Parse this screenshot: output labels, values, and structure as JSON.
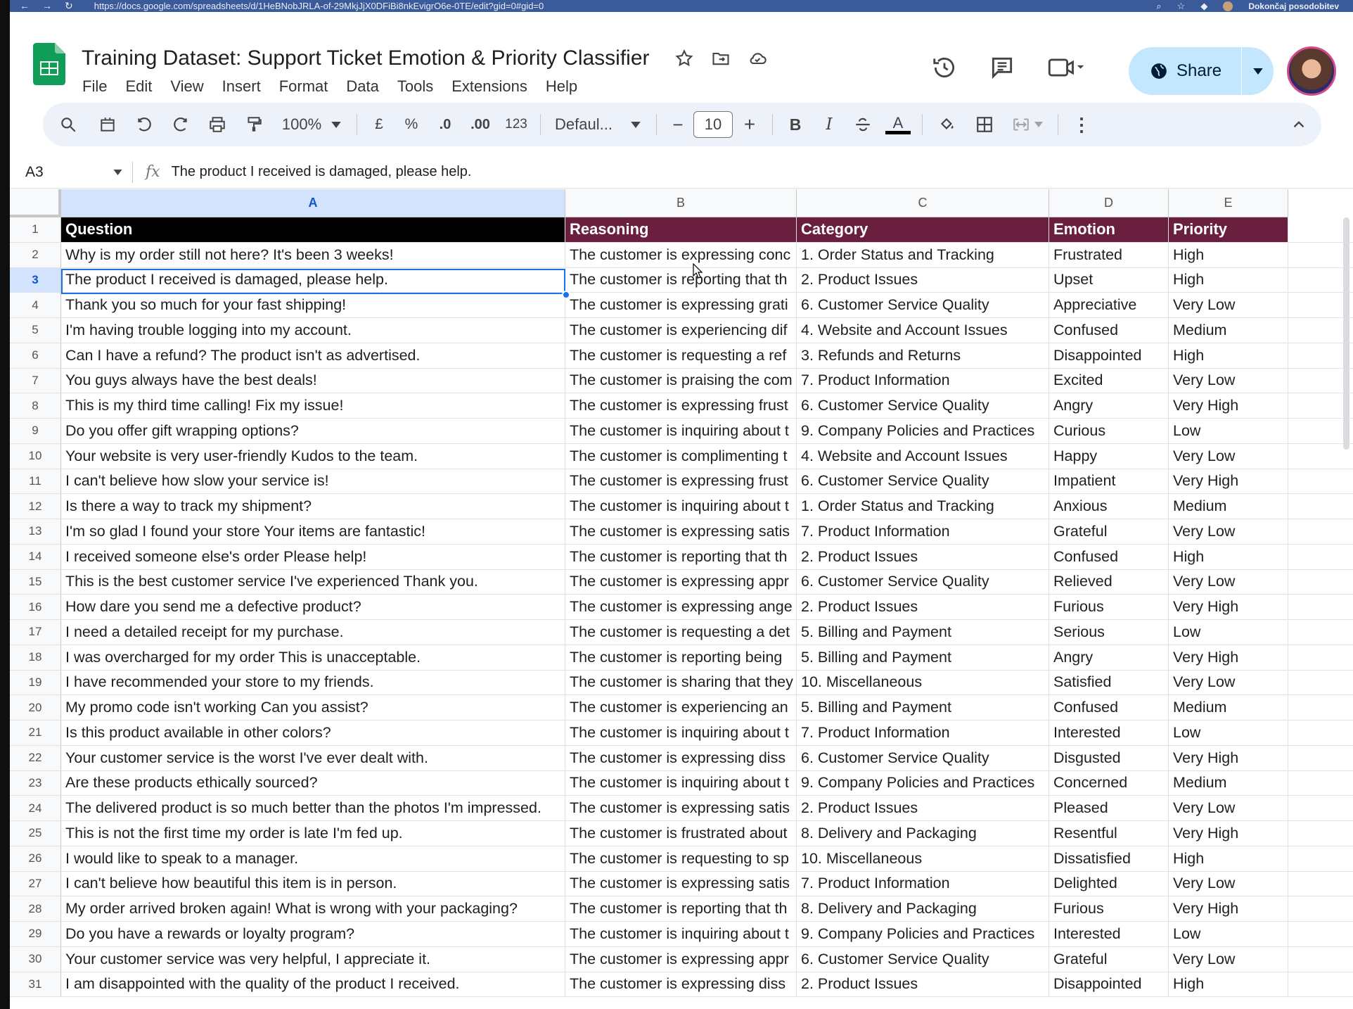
{
  "browser": {
    "url": "https://docs.google.com/spreadsheets/d/1HeBNobJRLA-of-29MkjJjX0DFiBi8nkEvigrO6e-0TE/edit?gid=0#gid=0",
    "update_label": "Dokončaj posodobitev"
  },
  "doc": {
    "title": "Training Dataset: Support Ticket Emotion & Priority Classifier",
    "menus": [
      "File",
      "Edit",
      "View",
      "Insert",
      "Format",
      "Data",
      "Tools",
      "Extensions",
      "Help"
    ],
    "share_label": "Share"
  },
  "toolbar": {
    "zoom": "100%",
    "currency": "£",
    "percent": "%",
    "dec_decrease": ".0",
    "dec_increase": ".00",
    "number_format": "123",
    "font": "Defaul...",
    "font_size": "10",
    "bold": "B",
    "italic": "I",
    "text_color": "A"
  },
  "formula_bar": {
    "cell_ref": "A3",
    "fx": "fx",
    "value": "The product I received is damaged, please help."
  },
  "columns": [
    "A",
    "B",
    "C",
    "D",
    "E"
  ],
  "header_row": {
    "num": "1",
    "cells": [
      "Question",
      "Reasoning",
      "Category",
      "Emotion",
      "Priority"
    ]
  },
  "rows": [
    {
      "num": "2",
      "cells": [
        "Why is my order still not here? It's been 3 weeks!",
        "The customer is expressing conc",
        "1. Order Status and Tracking",
        "Frustrated",
        "High"
      ]
    },
    {
      "num": "3",
      "cells": [
        "The product I received is damaged, please help.",
        "The customer is reporting that th",
        "2. Product Issues",
        "Upset",
        "High"
      ]
    },
    {
      "num": "4",
      "cells": [
        "Thank you so much for your fast shipping!",
        "The customer is expressing grati",
        "6. Customer Service Quality",
        "Appreciative",
        "Very Low"
      ]
    },
    {
      "num": "5",
      "cells": [
        "I'm having trouble logging into my account.",
        "The customer is experiencing dif",
        "4. Website and Account Issues",
        "Confused",
        "Medium"
      ]
    },
    {
      "num": "6",
      "cells": [
        "Can I have a refund? The product isn't as advertised.",
        "The customer is requesting a ref",
        "3. Refunds and Returns",
        "Disappointed",
        "High"
      ]
    },
    {
      "num": "7",
      "cells": [
        "You guys always have the best deals!",
        "The customer is praising the com",
        "7. Product Information",
        "Excited",
        "Very Low"
      ]
    },
    {
      "num": "8",
      "cells": [
        "This is my third time calling! Fix my issue!",
        "The customer is expressing frust",
        "6. Customer Service Quality",
        "Angry",
        "Very High"
      ]
    },
    {
      "num": "9",
      "cells": [
        "Do you offer gift wrapping options?",
        "The customer is inquiring about t",
        "9. Company Policies and Practices",
        "Curious",
        "Low"
      ]
    },
    {
      "num": "10",
      "cells": [
        "Your website is very user-friendly Kudos to the team.",
        "The customer is complimenting t",
        "4. Website and Account Issues",
        "Happy",
        "Very Low"
      ]
    },
    {
      "num": "11",
      "cells": [
        "I can't believe how slow your service is!",
        "The customer is expressing frust",
        "6. Customer Service Quality",
        "Impatient",
        "Very High"
      ]
    },
    {
      "num": "12",
      "cells": [
        "Is there a way to track my shipment?",
        "The customer is inquiring about t",
        "1. Order Status and Tracking",
        "Anxious",
        "Medium"
      ]
    },
    {
      "num": "13",
      "cells": [
        "I'm so glad I found your store Your items are fantastic!",
        "The customer is expressing satis",
        "7. Product Information",
        "Grateful",
        "Very Low"
      ]
    },
    {
      "num": "14",
      "cells": [
        "I received someone else's order Please help!",
        "The customer is reporting that th",
        "2. Product Issues",
        "Confused",
        "High"
      ]
    },
    {
      "num": "15",
      "cells": [
        "This is the best customer service I've experienced Thank you.",
        "The customer is expressing appr",
        "6. Customer Service Quality",
        "Relieved",
        "Very Low"
      ]
    },
    {
      "num": "16",
      "cells": [
        "How dare you send me a defective product?",
        "The customer is expressing ange",
        "2. Product Issues",
        "Furious",
        "Very High"
      ]
    },
    {
      "num": "17",
      "cells": [
        "I need a detailed receipt for my purchase.",
        "The customer is requesting a det",
        "5. Billing and Payment",
        "Serious",
        "Low"
      ]
    },
    {
      "num": "18",
      "cells": [
        "I was overcharged for my order This is unacceptable.",
        "The customer is reporting being",
        "5. Billing and Payment",
        "Angry",
        "Very High"
      ]
    },
    {
      "num": "19",
      "cells": [
        "I have recommended your store to my friends.",
        "The customer is sharing that they",
        "10. Miscellaneous",
        "Satisfied",
        "Very Low"
      ]
    },
    {
      "num": "20",
      "cells": [
        "My promo code isn't working Can you assist?",
        "The customer is experiencing an",
        "5. Billing and Payment",
        "Confused",
        "Medium"
      ]
    },
    {
      "num": "21",
      "cells": [
        "Is this product available in other colors?",
        "The customer is inquiring about t",
        "7. Product Information",
        "Interested",
        "Low"
      ]
    },
    {
      "num": "22",
      "cells": [
        "Your customer service is the worst I've ever dealt with.",
        "The customer is expressing diss",
        "6. Customer Service Quality",
        "Disgusted",
        "Very High"
      ]
    },
    {
      "num": "23",
      "cells": [
        "Are these products ethically sourced?",
        "The customer is inquiring about t",
        "9. Company Policies and Practices",
        "Concerned",
        "Medium"
      ]
    },
    {
      "num": "24",
      "cells": [
        "The delivered product is so much better than the photos I'm impressed.",
        "The customer is expressing satis",
        "2. Product Issues",
        "Pleased",
        "Very Low"
      ]
    },
    {
      "num": "25",
      "cells": [
        "This is not the first time my order is late I'm fed up.",
        "The customer is frustrated about",
        "8. Delivery and Packaging",
        "Resentful",
        "Very High"
      ]
    },
    {
      "num": "26",
      "cells": [
        "I would like to speak to a manager.",
        "The customer is requesting to sp",
        "10. Miscellaneous",
        "Dissatisfied",
        "High"
      ]
    },
    {
      "num": "27",
      "cells": [
        "I can't believe how beautiful this item is in person.",
        "The customer is expressing satis",
        "7. Product Information",
        "Delighted",
        "Very Low"
      ]
    },
    {
      "num": "28",
      "cells": [
        "My order arrived broken again! What is wrong with your packaging?",
        "The customer is reporting that th",
        "8. Delivery and Packaging",
        "Furious",
        "Very High"
      ]
    },
    {
      "num": "29",
      "cells": [
        "Do you have a rewards or loyalty program?",
        "The customer is inquiring about t",
        "9. Company Policies and Practices",
        "Interested",
        "Low"
      ]
    },
    {
      "num": "30",
      "cells": [
        "Your customer service was very helpful, I appreciate it.",
        "The customer is expressing appr",
        "6. Customer Service Quality",
        "Grateful",
        "Very Low"
      ]
    },
    {
      "num": "31",
      "cells": [
        "I am disappointed with the quality of the product I received.",
        "The customer is expressing diss",
        "2. Product Issues",
        "Disappointed",
        "High"
      ]
    }
  ],
  "selected_row": "3",
  "selected_column": "A"
}
